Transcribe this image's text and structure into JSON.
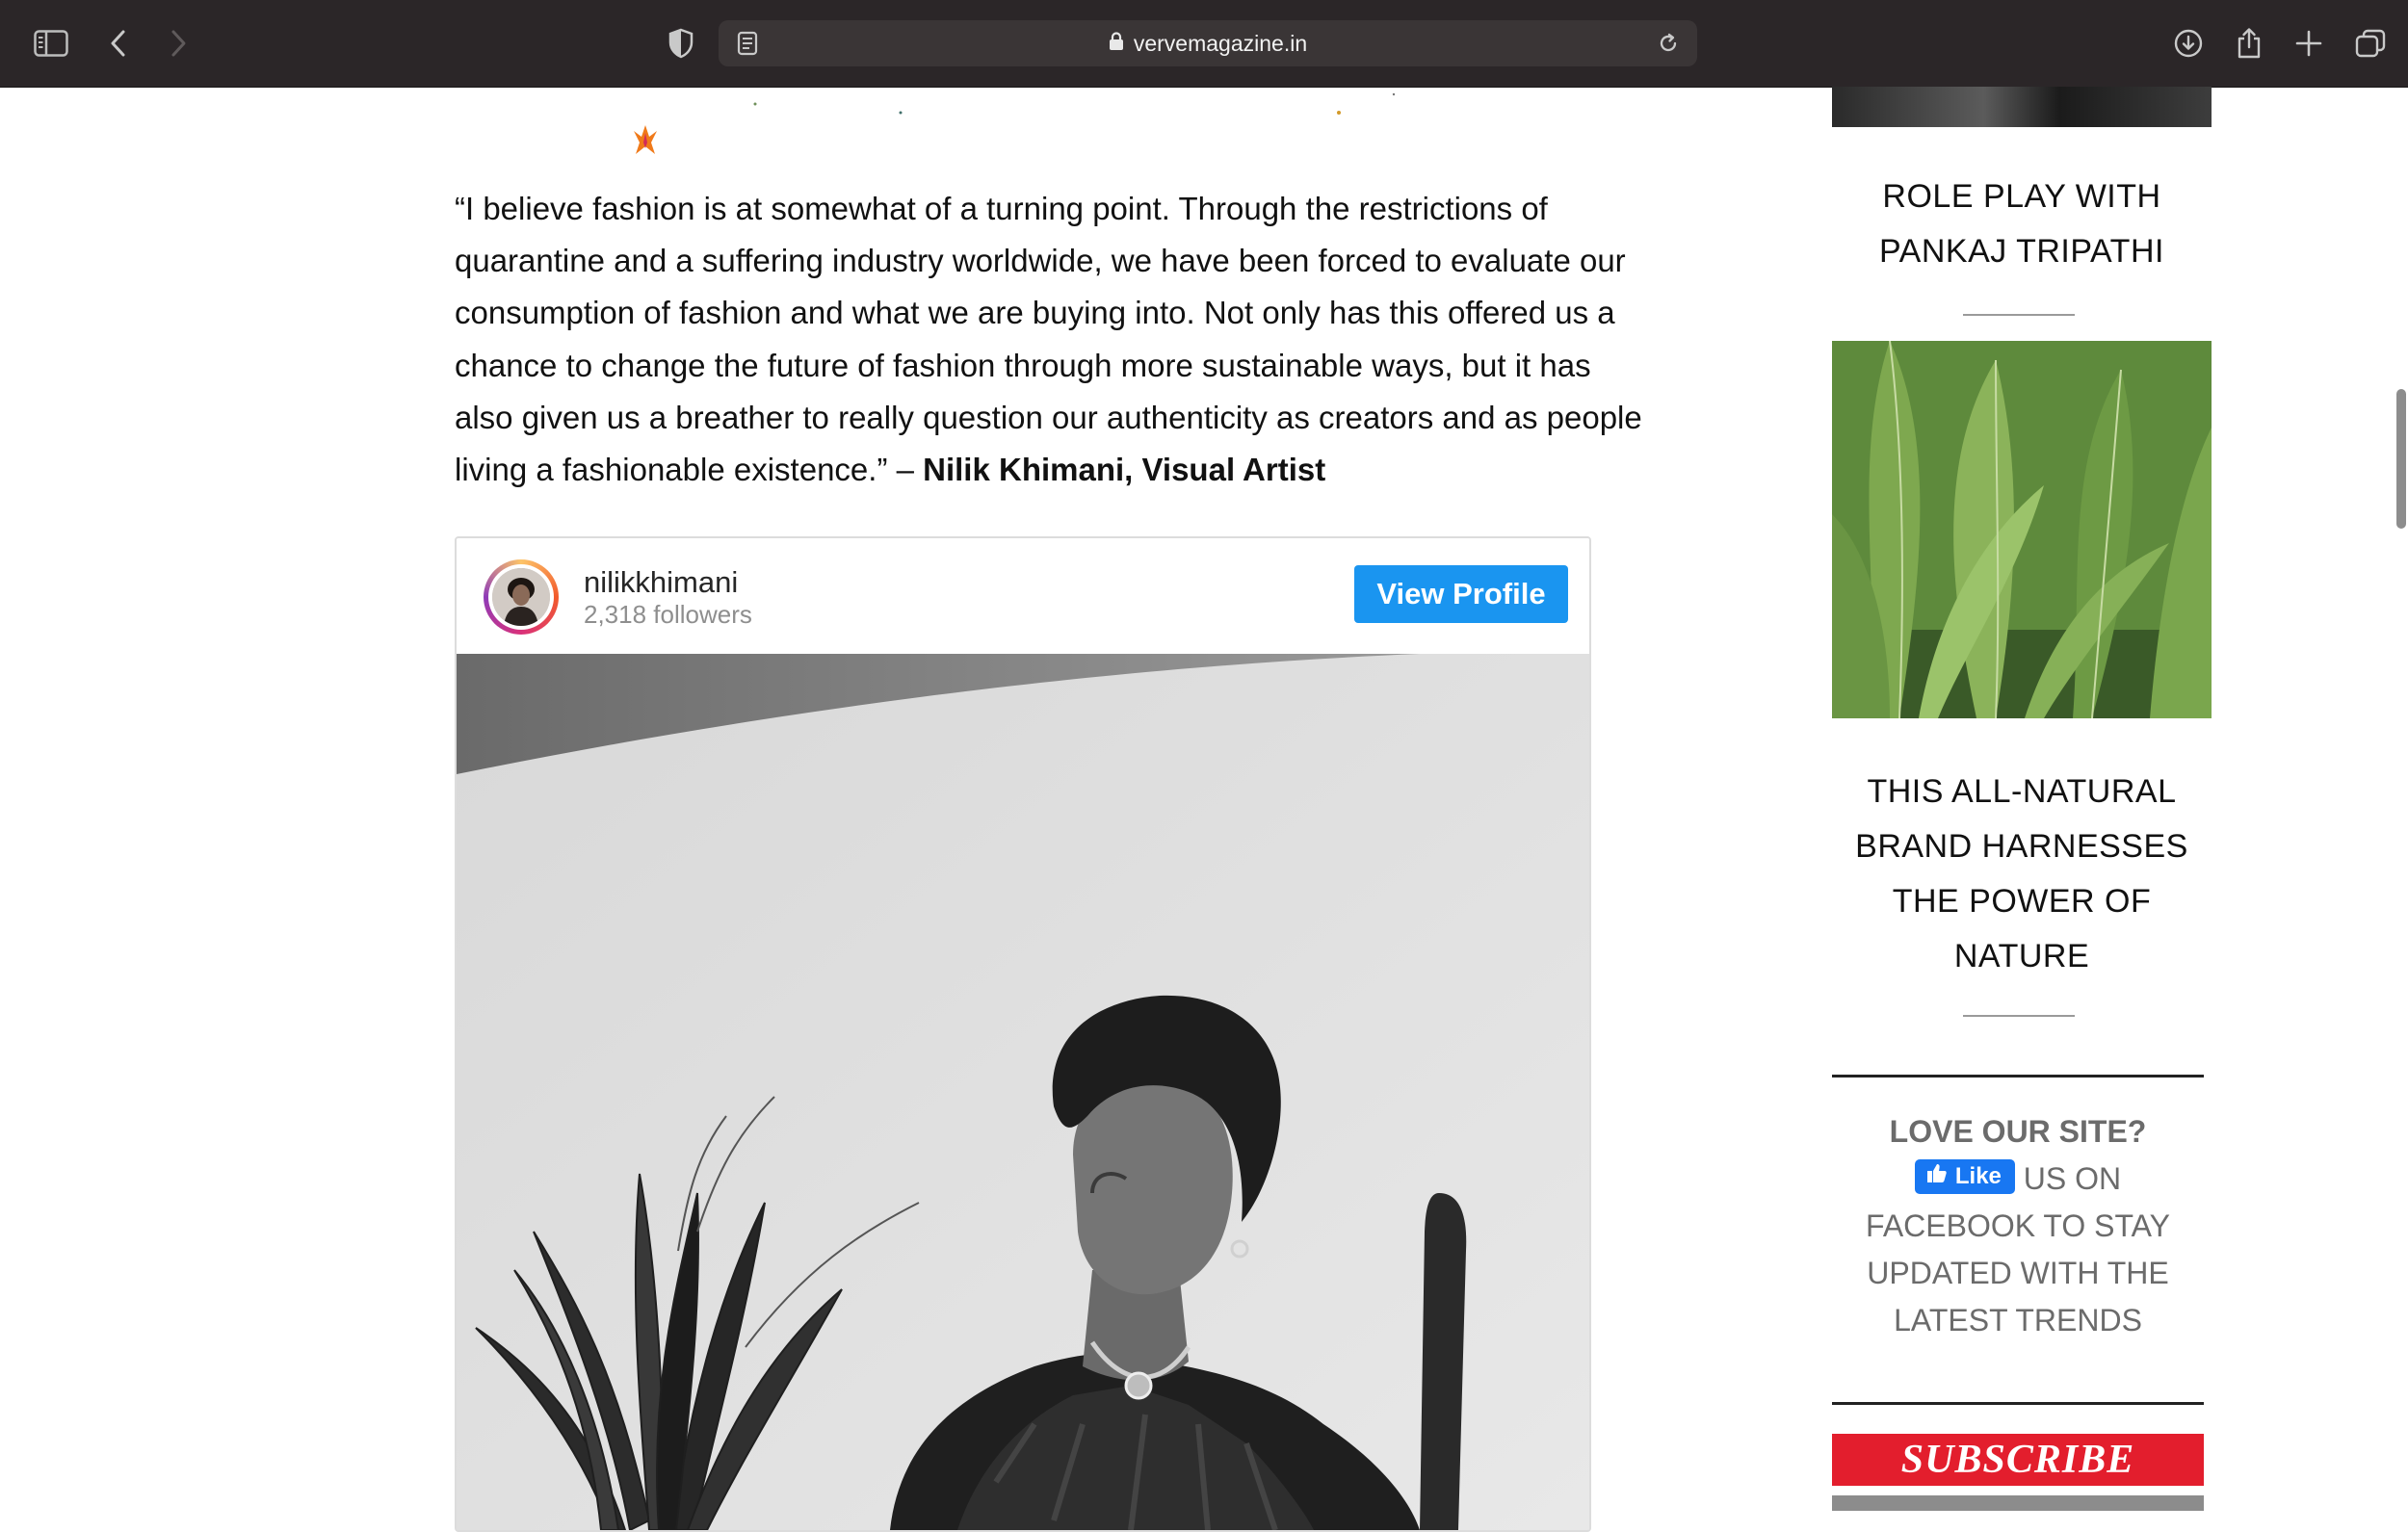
{
  "browser": {
    "url": "vervemagazine.in",
    "icons": [
      "sidebar-toggle-icon",
      "back-icon",
      "forward-icon",
      "privacy-shield-icon",
      "reader-icon",
      "lock-icon",
      "reload-icon",
      "download-icon",
      "share-icon",
      "new-tab-icon",
      "tab-overview-icon"
    ]
  },
  "article": {
    "quote": "“I believe fashion is at somewhat of a turning point. Through the restrictions of quarantine and a suffering industry worldwide, we have been forced to evaluate our consumption of fashion and what we are buying into. Not only has this offered us a chance to change the future of fashion through more sustainable ways, but it has also given us a breather to really question our authenticity as creators and as people living a fashionable existence.” – ",
    "attribution": "Nilik Khimani, Visual Artist"
  },
  "instagram_embed": {
    "username": "nilikkhimani",
    "followers": "2,318 followers",
    "view_profile_label": "View Profile"
  },
  "sidebar": {
    "story1_title": "ROLE PLAY WITH PANKAJ TRIPATHI",
    "story2_title": "THIS ALL-NATURAL BRAND HARNESSES THE POWER OF NATURE",
    "love_title": "LOVE OUR SITE?",
    "like_label": "Like",
    "love_text_1": "US ON",
    "love_text_2": "FACEBOOK TO STAY UPDATED WITH THE LATEST TRENDS",
    "subscribe_label": "SUBSCRIBE"
  },
  "colors": {
    "toolbar_bg": "#2b2628",
    "view_profile_blue": "#1a95f0",
    "facebook_blue": "#1877f2",
    "subscribe_red": "#e31e2d"
  }
}
